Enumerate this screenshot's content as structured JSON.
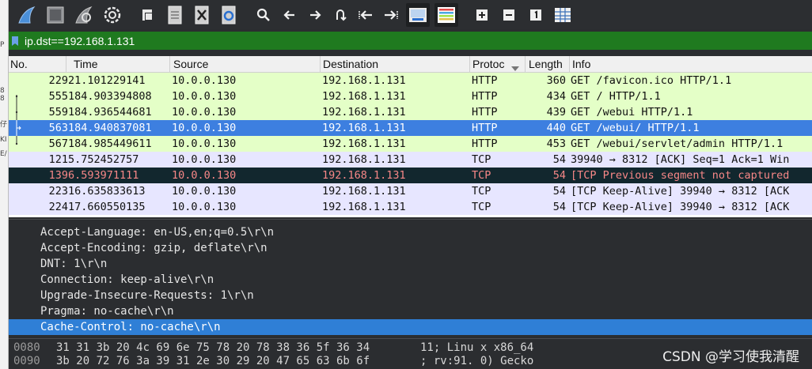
{
  "colors": {
    "http_row_bg": "#e4ffc7",
    "tcp_row_bg": "#e7e6ff",
    "selected_bg": "#3d7fe0",
    "bad_row_bg": "#12272e",
    "bad_row_fg": "#f78787",
    "filter_bg": "#1f7a1f"
  },
  "gutter": [
    "P",
    "8",
    "8",
    "仔",
    "KI",
    "E/"
  ],
  "toolbar": {
    "icons": [
      "shark-fin-start-icon",
      "stop-capture-icon",
      "restart-capture-icon",
      "capture-options-icon",
      "open-file-icon",
      "save-file-icon",
      "close-file-icon",
      "reload-file-icon",
      "find-packet-icon",
      "go-back-icon",
      "go-forward-icon",
      "go-to-packet-icon",
      "first-packet-icon",
      "last-packet-icon",
      "autoscroll-icon",
      "colorize-icon",
      "zoom-in-icon",
      "zoom-out-icon",
      "normal-size-icon",
      "resize-columns-icon"
    ]
  },
  "filter": {
    "value": "ip.dst==192.168.1.131"
  },
  "packet_list": {
    "columns": {
      "no": "No.",
      "time": "Time",
      "source": "Source",
      "destination": "Destination",
      "protocol": "Protoc",
      "length": "Length",
      "info": "Info"
    },
    "rows": [
      {
        "no": "229",
        "time": "21.101229141",
        "source": "10.0.0.130",
        "destination": "192.168.1.131",
        "protocol": "HTTP",
        "length": "360",
        "info": "GET /favicon.ico HTTP/1.1",
        "kind": "http"
      },
      {
        "no": "555",
        "time": "184.903394808",
        "source": "10.0.0.130",
        "destination": "192.168.1.131",
        "protocol": "HTTP",
        "length": "434",
        "info": "GET / HTTP/1.1",
        "kind": "http"
      },
      {
        "no": "559",
        "time": "184.936544681",
        "source": "10.0.0.130",
        "destination": "192.168.1.131",
        "protocol": "HTTP",
        "length": "439",
        "info": "GET /webui HTTP/1.1",
        "kind": "http"
      },
      {
        "no": "563",
        "time": "184.940837081",
        "source": "10.0.0.130",
        "destination": "192.168.1.131",
        "protocol": "HTTP",
        "length": "440",
        "info": "GET /webui/ HTTP/1.1",
        "kind": "selected"
      },
      {
        "no": "567",
        "time": "184.985449611",
        "source": "10.0.0.130",
        "destination": "192.168.1.131",
        "protocol": "HTTP",
        "length": "453",
        "info": "GET /webui/servlet/admin HTTP/1.1",
        "kind": "http"
      },
      {
        "no": "121",
        "time": "5.752452757",
        "source": "10.0.0.130",
        "destination": "192.168.1.131",
        "protocol": "TCP",
        "length": "54",
        "info": "39940 → 8312 [ACK] Seq=1 Ack=1 Win",
        "kind": "tcp"
      },
      {
        "no": "139",
        "time": "6.593971111",
        "source": "10.0.0.130",
        "destination": "192.168.1.131",
        "protocol": "TCP",
        "length": "54",
        "info": "[TCP Previous segment not captured",
        "kind": "bad"
      },
      {
        "no": "223",
        "time": "16.635833613",
        "source": "10.0.0.130",
        "destination": "192.168.1.131",
        "protocol": "TCP",
        "length": "54",
        "info": "[TCP Keep-Alive] 39940 → 8312 [ACK",
        "kind": "tcp"
      },
      {
        "no": "224",
        "time": "17.660550135",
        "source": "10.0.0.130",
        "destination": "192.168.1.131",
        "protocol": "TCP",
        "length": "54",
        "info": "[TCP Keep-Alive] 39940 → 8312 [ACK",
        "kind": "tcp"
      }
    ]
  },
  "details": {
    "lines": [
      "Accept-Language: en-US,en;q=0.5\\r\\n",
      "Accept-Encoding: gzip, deflate\\r\\n",
      "DNT: 1\\r\\n",
      "Connection: keep-alive\\r\\n",
      "Upgrade-Insecure-Requests: 1\\r\\n",
      "Pragma: no-cache\\r\\n",
      "Cache-Control: no-cache\\r\\n"
    ],
    "selected_index": 6
  },
  "bytes": {
    "lines": [
      {
        "offset": "0080",
        "hex": "31 31 3b 20 4c 69 6e 75  78 20 78 38 36 5f 36 34",
        "ascii": "11; Linu x x86_64"
      },
      {
        "offset": "0090",
        "hex": "3b 20 72 76 3a 39 31 2e  30 29 20 47 65 63 6b 6f",
        "ascii": "; rv:91. 0) Gecko"
      }
    ]
  },
  "watermark": "CSDN @学习使我清醒"
}
